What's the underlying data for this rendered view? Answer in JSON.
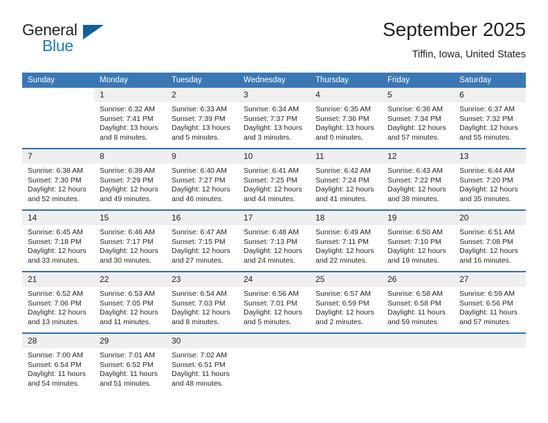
{
  "brand": {
    "name_top": "General",
    "name_bottom": "Blue",
    "flag_icon": "triangle-flag-icon",
    "accent_color": "#1f7ac4",
    "flag_color": "#10609f"
  },
  "header": {
    "title": "September 2025",
    "subtitle": "Tiffin, Iowa, United States"
  },
  "calendar": {
    "header_bg": "#3a78b5",
    "daynum_bg": "#efefef",
    "separator_color": "#2c6fae",
    "weekday_headers": [
      "Sunday",
      "Monday",
      "Tuesday",
      "Wednesday",
      "Thursday",
      "Friday",
      "Saturday"
    ],
    "weeks": [
      [
        {
          "day": "",
          "blank": true,
          "lines": []
        },
        {
          "day": "1",
          "lines": [
            "Sunrise: 6:32 AM",
            "Sunset: 7:41 PM",
            "Daylight: 13 hours",
            "and 8 minutes."
          ]
        },
        {
          "day": "2",
          "lines": [
            "Sunrise: 6:33 AM",
            "Sunset: 7:39 PM",
            "Daylight: 13 hours",
            "and 5 minutes."
          ]
        },
        {
          "day": "3",
          "lines": [
            "Sunrise: 6:34 AM",
            "Sunset: 7:37 PM",
            "Daylight: 13 hours",
            "and 3 minutes."
          ]
        },
        {
          "day": "4",
          "lines": [
            "Sunrise: 6:35 AM",
            "Sunset: 7:36 PM",
            "Daylight: 13 hours",
            "and 0 minutes."
          ]
        },
        {
          "day": "5",
          "lines": [
            "Sunrise: 6:36 AM",
            "Sunset: 7:34 PM",
            "Daylight: 12 hours",
            "and 57 minutes."
          ]
        },
        {
          "day": "6",
          "lines": [
            "Sunrise: 6:37 AM",
            "Sunset: 7:32 PM",
            "Daylight: 12 hours",
            "and 55 minutes."
          ]
        }
      ],
      [
        {
          "day": "7",
          "lines": [
            "Sunrise: 6:38 AM",
            "Sunset: 7:30 PM",
            "Daylight: 12 hours",
            "and 52 minutes."
          ]
        },
        {
          "day": "8",
          "lines": [
            "Sunrise: 6:39 AM",
            "Sunset: 7:29 PM",
            "Daylight: 12 hours",
            "and 49 minutes."
          ]
        },
        {
          "day": "9",
          "lines": [
            "Sunrise: 6:40 AM",
            "Sunset: 7:27 PM",
            "Daylight: 12 hours",
            "and 46 minutes."
          ]
        },
        {
          "day": "10",
          "lines": [
            "Sunrise: 6:41 AM",
            "Sunset: 7:25 PM",
            "Daylight: 12 hours",
            "and 44 minutes."
          ]
        },
        {
          "day": "11",
          "lines": [
            "Sunrise: 6:42 AM",
            "Sunset: 7:24 PM",
            "Daylight: 12 hours",
            "and 41 minutes."
          ]
        },
        {
          "day": "12",
          "lines": [
            "Sunrise: 6:43 AM",
            "Sunset: 7:22 PM",
            "Daylight: 12 hours",
            "and 38 minutes."
          ]
        },
        {
          "day": "13",
          "lines": [
            "Sunrise: 6:44 AM",
            "Sunset: 7:20 PM",
            "Daylight: 12 hours",
            "and 35 minutes."
          ]
        }
      ],
      [
        {
          "day": "14",
          "lines": [
            "Sunrise: 6:45 AM",
            "Sunset: 7:18 PM",
            "Daylight: 12 hours",
            "and 33 minutes."
          ]
        },
        {
          "day": "15",
          "lines": [
            "Sunrise: 6:46 AM",
            "Sunset: 7:17 PM",
            "Daylight: 12 hours",
            "and 30 minutes."
          ]
        },
        {
          "day": "16",
          "lines": [
            "Sunrise: 6:47 AM",
            "Sunset: 7:15 PM",
            "Daylight: 12 hours",
            "and 27 minutes."
          ]
        },
        {
          "day": "17",
          "lines": [
            "Sunrise: 6:48 AM",
            "Sunset: 7:13 PM",
            "Daylight: 12 hours",
            "and 24 minutes."
          ]
        },
        {
          "day": "18",
          "lines": [
            "Sunrise: 6:49 AM",
            "Sunset: 7:11 PM",
            "Daylight: 12 hours",
            "and 22 minutes."
          ]
        },
        {
          "day": "19",
          "lines": [
            "Sunrise: 6:50 AM",
            "Sunset: 7:10 PM",
            "Daylight: 12 hours",
            "and 19 minutes."
          ]
        },
        {
          "day": "20",
          "lines": [
            "Sunrise: 6:51 AM",
            "Sunset: 7:08 PM",
            "Daylight: 12 hours",
            "and 16 minutes."
          ]
        }
      ],
      [
        {
          "day": "21",
          "lines": [
            "Sunrise: 6:52 AM",
            "Sunset: 7:06 PM",
            "Daylight: 12 hours",
            "and 13 minutes."
          ]
        },
        {
          "day": "22",
          "lines": [
            "Sunrise: 6:53 AM",
            "Sunset: 7:05 PM",
            "Daylight: 12 hours",
            "and 11 minutes."
          ]
        },
        {
          "day": "23",
          "lines": [
            "Sunrise: 6:54 AM",
            "Sunset: 7:03 PM",
            "Daylight: 12 hours",
            "and 8 minutes."
          ]
        },
        {
          "day": "24",
          "lines": [
            "Sunrise: 6:56 AM",
            "Sunset: 7:01 PM",
            "Daylight: 12 hours",
            "and 5 minutes."
          ]
        },
        {
          "day": "25",
          "lines": [
            "Sunrise: 6:57 AM",
            "Sunset: 6:59 PM",
            "Daylight: 12 hours",
            "and 2 minutes."
          ]
        },
        {
          "day": "26",
          "lines": [
            "Sunrise: 6:58 AM",
            "Sunset: 6:58 PM",
            "Daylight: 11 hours",
            "and 59 minutes."
          ]
        },
        {
          "day": "27",
          "lines": [
            "Sunrise: 6:59 AM",
            "Sunset: 6:56 PM",
            "Daylight: 11 hours",
            "and 57 minutes."
          ]
        }
      ],
      [
        {
          "day": "28",
          "lines": [
            "Sunrise: 7:00 AM",
            "Sunset: 6:54 PM",
            "Daylight: 11 hours",
            "and 54 minutes."
          ]
        },
        {
          "day": "29",
          "lines": [
            "Sunrise: 7:01 AM",
            "Sunset: 6:52 PM",
            "Daylight: 11 hours",
            "and 51 minutes."
          ]
        },
        {
          "day": "30",
          "lines": [
            "Sunrise: 7:02 AM",
            "Sunset: 6:51 PM",
            "Daylight: 11 hours",
            "and 48 minutes."
          ]
        },
        {
          "day": "",
          "empty": true,
          "lines": []
        },
        {
          "day": "",
          "empty": true,
          "lines": []
        },
        {
          "day": "",
          "empty": true,
          "lines": []
        },
        {
          "day": "",
          "empty": true,
          "lines": []
        }
      ]
    ]
  }
}
